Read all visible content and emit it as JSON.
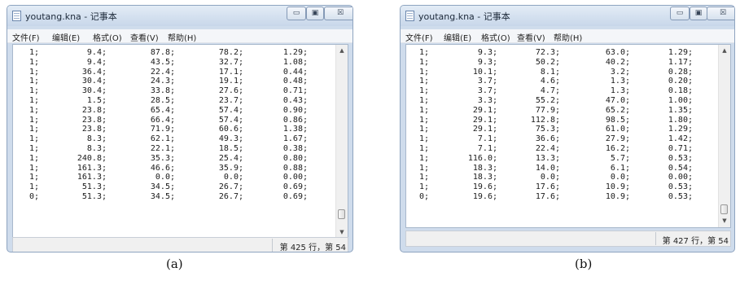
{
  "windows": [
    {
      "title": "youtang.kna - 记事本",
      "menu": [
        "文件(F)",
        "编辑(E)",
        "格式(O)",
        "查看(V)",
        "帮助(H)"
      ],
      "controls": {
        "minimize": "▭",
        "maximize": "▣",
        "close": "☒"
      },
      "rows": [
        [
          "1;",
          "9.4;",
          "87.8;",
          "78.2;",
          "1.29;"
        ],
        [
          "1;",
          "9.4;",
          "43.5;",
          "32.7;",
          "1.08;"
        ],
        [
          "1;",
          "36.4;",
          "22.4;",
          "17.1;",
          "0.44;"
        ],
        [
          "1;",
          "30.4;",
          "24.3;",
          "19.1;",
          "0.48;"
        ],
        [
          "1;",
          "30.4;",
          "33.8;",
          "27.6;",
          "0.71;"
        ],
        [
          "1;",
          "1.5;",
          "28.5;",
          "23.7;",
          "0.43;"
        ],
        [
          "1;",
          "23.8;",
          "65.4;",
          "57.4;",
          "0.90;"
        ],
        [
          "1;",
          "23.8;",
          "66.4;",
          "57.4;",
          "0.86;"
        ],
        [
          "1;",
          "23.8;",
          "71.9;",
          "60.6;",
          "1.38;"
        ],
        [
          "1;",
          "8.3;",
          "62.1;",
          "49.3;",
          "1.67;"
        ],
        [
          "1;",
          "8.3;",
          "22.1;",
          "18.5;",
          "0.38;"
        ],
        [
          "1;",
          "240.8;",
          "35.3;",
          "25.4;",
          "0.80;"
        ],
        [
          "1;",
          "161.3;",
          "46.6;",
          "35.9;",
          "0.88;"
        ],
        [
          "1;",
          "161.3;",
          "0.0;",
          "0.0;",
          "0.00;"
        ],
        [
          "1;",
          "51.3;",
          "34.5;",
          "26.7;",
          "0.69;"
        ],
        [
          "0;",
          "51.3;",
          "34.5;",
          "26.7;",
          "0.69;"
        ]
      ],
      "status": "第 425 行，第 54",
      "caption": "(a)"
    },
    {
      "title": "youtang.kna - 记事本",
      "menu": [
        "文件(F)",
        "编辑(E)",
        "格式(O)",
        "查看(V)",
        "帮助(H)"
      ],
      "controls": {
        "minimize": "▭",
        "maximize": "▣",
        "close": "☒"
      },
      "rows": [
        [
          "1;",
          "9.3;",
          "72.3;",
          "63.0;",
          "1.29;"
        ],
        [
          "1;",
          "9.3;",
          "50.2;",
          "40.2;",
          "1.17;"
        ],
        [
          "1;",
          "10.1;",
          "8.1;",
          "3.2;",
          "0.28;"
        ],
        [
          "1;",
          "3.7;",
          "4.6;",
          "1.3;",
          "0.20;"
        ],
        [
          "1;",
          "3.7;",
          "4.7;",
          "1.3;",
          "0.18;"
        ],
        [
          "1;",
          "3.3;",
          "55.2;",
          "47.0;",
          "1.00;"
        ],
        [
          "1;",
          "29.1;",
          "77.9;",
          "65.2;",
          "1.35;"
        ],
        [
          "1;",
          "29.1;",
          "112.8;",
          "98.5;",
          "1.80;"
        ],
        [
          "1;",
          "29.1;",
          "75.3;",
          "61.0;",
          "1.29;"
        ],
        [
          "1;",
          "7.1;",
          "36.6;",
          "27.9;",
          "1.42;"
        ],
        [
          "1;",
          "7.1;",
          "22.4;",
          "16.2;",
          "0.71;"
        ],
        [
          "1;",
          "116.0;",
          "13.3;",
          "5.7;",
          "0.53;"
        ],
        [
          "1;",
          "18.3;",
          "14.0;",
          "6.1;",
          "0.54;"
        ],
        [
          "1;",
          "18.3;",
          "0.0;",
          "0.0;",
          "0.00;"
        ],
        [
          "1;",
          "19.6;",
          "17.6;",
          "10.9;",
          "0.53;"
        ],
        [
          "0;",
          "19.6;",
          "17.6;",
          "10.9;",
          "0.53;"
        ]
      ],
      "status": "第 427 行，第 54",
      "caption": "(b)"
    }
  ]
}
